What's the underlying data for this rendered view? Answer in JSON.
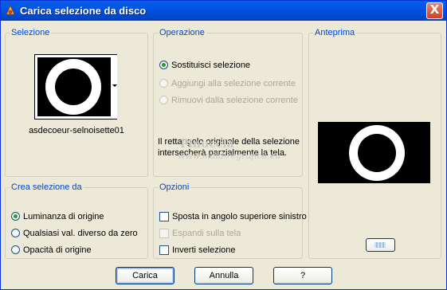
{
  "window": {
    "title": "Carica selezione da disco",
    "close_label": "X"
  },
  "selection": {
    "legend": "Selezione",
    "file_name": "asdecoeur-selnoisette01"
  },
  "operation": {
    "legend": "Operazione",
    "options": [
      {
        "label": "Sostituisci selezione",
        "selected": true,
        "enabled": true
      },
      {
        "label": "Aggiungi alla selezione corrente",
        "selected": false,
        "enabled": false
      },
      {
        "label": "Rimuovi dalla selezione corrente",
        "selected": false,
        "enabled": false
      }
    ],
    "description": "Il rettangolo originale della selezione intersecherà parzialmente la tela."
  },
  "watermark": {
    "line1": "Pinuccia",
    "line2": "www.maidiregrafica.eu"
  },
  "create_from": {
    "legend": "Crea selezione da",
    "options": [
      {
        "label": "Luminanza di origine",
        "selected": true
      },
      {
        "label": "Qualsiasi val. diverso da zero",
        "selected": false
      },
      {
        "label": "Opacità di origine",
        "selected": false
      }
    ]
  },
  "options": {
    "legend": "Opzioni",
    "items": [
      {
        "label": "Sposta in angolo superiore sinistro",
        "checked": false,
        "enabled": true
      },
      {
        "label": "Espandi sulla tela",
        "checked": false,
        "enabled": false
      },
      {
        "label": "Inverti selezione",
        "checked": false,
        "enabled": true
      }
    ]
  },
  "preview": {
    "legend": "Anteprima"
  },
  "buttons": {
    "load": "Carica",
    "cancel": "Annulla",
    "help": "?"
  },
  "colors": {
    "titlebar": "#0054e3",
    "legend": "#0046d5",
    "dialog_bg": "#ece9d8",
    "radio_on": "#21a121"
  }
}
